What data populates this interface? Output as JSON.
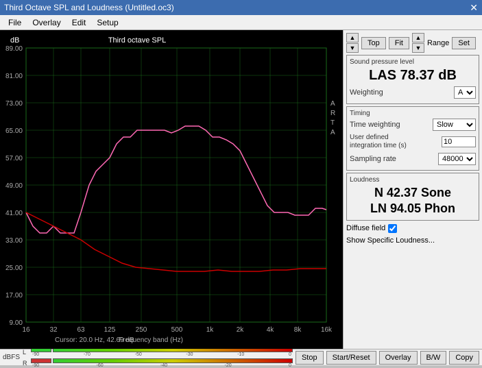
{
  "window": {
    "title": "Third Octave SPL and Loudness (Untitled.oc3)",
    "close_label": "✕"
  },
  "menu": {
    "items": [
      "File",
      "Overlay",
      "Edit",
      "Setup"
    ]
  },
  "top_controls": {
    "top_label": "Top",
    "fit_label": "Fit",
    "range_label": "Range",
    "set_label": "Set"
  },
  "spl": {
    "section_label": "Sound pressure level",
    "value": "LAS 78.37 dB",
    "weighting_label": "Weighting",
    "weighting_value": "A"
  },
  "timing": {
    "section_label": "Timing",
    "time_weighting_label": "Time weighting",
    "time_weighting_value": "Slow",
    "integration_label": "User defined integration time (s)",
    "integration_value": "10",
    "sampling_label": "Sampling rate",
    "sampling_value": "48000"
  },
  "loudness": {
    "section_label": "Loudness",
    "n_value": "N 42.37 Sone",
    "ln_value": "LN 94.05 Phon",
    "diffuse_label": "Diffuse field",
    "show_specific_label": "Show Specific Loudness..."
  },
  "chart": {
    "title": "Third octave SPL",
    "y_label": "dB",
    "y_ticks": [
      "89.00",
      "81.00",
      "73.00",
      "65.00",
      "57.00",
      "49.00",
      "41.00",
      "33.00",
      "25.00",
      "17.00",
      "9.00"
    ],
    "x_ticks": [
      "16",
      "32",
      "63",
      "125",
      "250",
      "500",
      "1k",
      "2k",
      "4k",
      "8k",
      "16k"
    ],
    "cursor_label": "Cursor: 20.0 Hz, 42.69 dB",
    "freq_label": "Frequency band (Hz)",
    "right_labels": [
      "A",
      "R",
      "T",
      "A"
    ]
  },
  "bottom": {
    "dbfs_label": "dBFS",
    "meter_ticks_L": [
      "-90",
      "-70",
      "-50",
      "-30",
      "-10",
      "0"
    ],
    "meter_ticks_R": [
      "-90",
      "-60",
      "-40",
      "-20",
      "0"
    ],
    "L_label": "L",
    "R_label": "R",
    "stop_label": "Stop",
    "start_reset_label": "Start/Reset",
    "overlay_label": "Overlay",
    "bw_label": "B/W",
    "copy_label": "Copy"
  }
}
